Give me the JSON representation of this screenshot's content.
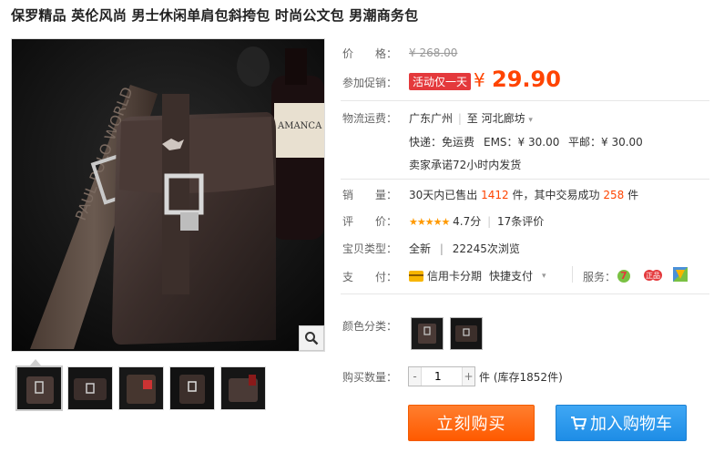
{
  "product": {
    "title": "保罗精品 英伦风尚 男士休闲单肩包斜挎包 时尚公文包 男潮商务包"
  },
  "price": {
    "label": "价　　格：",
    "original": "¥ 268.00"
  },
  "promo": {
    "label": "参加促销：",
    "tag": "活动仅一天",
    "yen": "¥",
    "price": "29.90"
  },
  "shipping": {
    "label": "物流运费：",
    "route_from": "广东广州",
    "route_sep": "|",
    "route_to_prefix": "至",
    "route_to": "河北廊坊",
    "express": "快递：免运费",
    "ems": "EMS：¥ 30.00",
    "mail": "平邮：¥ 30.00",
    "promise": "卖家承诺72小时内发货"
  },
  "sales": {
    "label": "销　　量：",
    "prefix": "30天内已售出",
    "sold": "1412",
    "mid": "件，其中交易成功",
    "success": "258",
    "suffix": "件"
  },
  "rating": {
    "label": "评　　价：",
    "stars": "★★★★★",
    "score": "4.7分",
    "sep": "|",
    "reviews": "17条评价"
  },
  "item_type": {
    "label": "宝贝类型：",
    "condition": "全新",
    "sep": "|",
    "views": "22245次浏览"
  },
  "payment": {
    "label": "支　　付：",
    "credit": "信用卡分期",
    "quick": "快捷支付",
    "service_label": "服务："
  },
  "color": {
    "label": "颜色分类："
  },
  "quantity": {
    "label": "购买数量：",
    "minus": "-",
    "value": "1",
    "plus": "+",
    "unit": "件",
    "stock": "(库存1852件)"
  },
  "buttons": {
    "buy_now": "立刻购买",
    "add_cart": "加入购物车"
  },
  "colors": {
    "accent": "#ff4400",
    "promo_red": "#e4393c",
    "buy_orange": "#ff6a00",
    "cart_blue": "#2f9bef"
  }
}
